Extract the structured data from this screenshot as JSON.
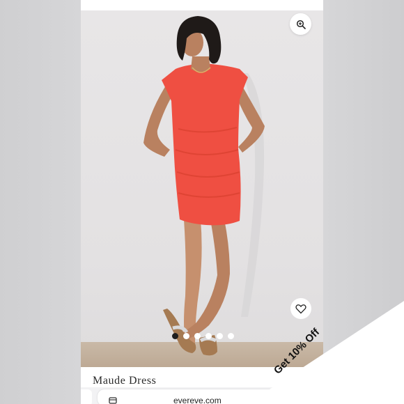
{
  "product": {
    "title": "Maude Dress",
    "dress_color": "#ef4f42"
  },
  "gallery": {
    "total_images": 6,
    "active_index": 0,
    "zoom_icon": "zoom-in-icon",
    "wishlist_icon": "heart-icon"
  },
  "promo": {
    "label": "Get 10% Off"
  },
  "browser": {
    "url": "evereve.com",
    "tabs_icon": "tabs-icon",
    "reload_icon": "reload-icon"
  }
}
